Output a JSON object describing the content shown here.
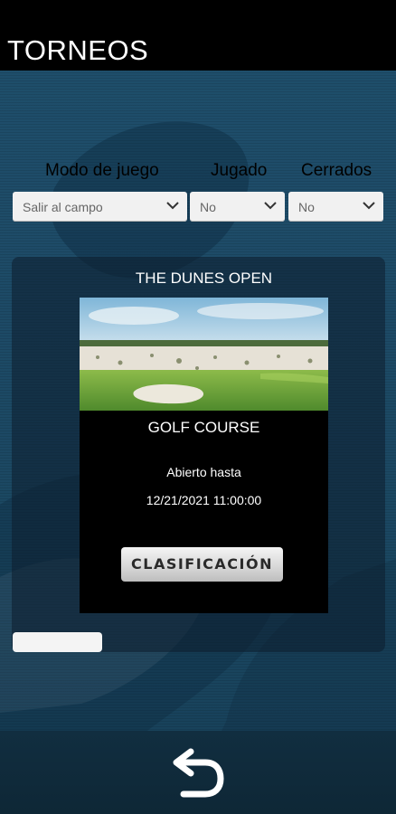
{
  "header": {
    "title": "TORNEOS"
  },
  "filters": [
    {
      "label": "Modo de juego",
      "value": "Salir al campo"
    },
    {
      "label": "Jugado",
      "value": "No"
    },
    {
      "label": "Cerrados",
      "value": "No"
    }
  ],
  "tournament": {
    "name": "THE DUNES OPEN",
    "course": "GOLF COURSE",
    "open_label": "Abierto hasta",
    "open_date": "12/21/2021 11:00:00",
    "ranking_button": "CLASIFICACIÓN"
  },
  "icons": {
    "back": "back-arrow-icon",
    "dropdown": "chevron-down-icon"
  },
  "colors": {
    "background": "#1d4a66",
    "header": "#000000",
    "button": "#d9d9d9"
  }
}
